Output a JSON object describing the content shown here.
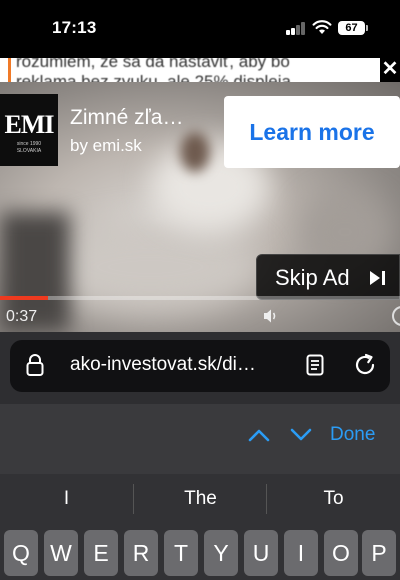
{
  "status_bar": {
    "time": "17:13",
    "battery": "67"
  },
  "article": {
    "line1": "rozumiem, že sa dá nastaviť, aby bo",
    "line2": "reklama bez zvuku, ale 25% displeja"
  },
  "ad": {
    "logo_text": "EMI",
    "logo_sub1": "since 1990",
    "logo_sub2": "SLOVAKIA",
    "title": "Zimné zľa…",
    "by": "by emi.sk",
    "learn_more": "Learn more",
    "skip": "Skip Ad",
    "elapsed": "0:37",
    "progress": 0.12,
    "close": "✕"
  },
  "browser": {
    "url": "ako-investovat.sk/di…"
  },
  "find_bar": {
    "done": "Done"
  },
  "keyboard": {
    "suggestions": [
      "I",
      "The",
      "To"
    ],
    "keys": [
      "Q",
      "W",
      "E",
      "R",
      "T",
      "Y",
      "U",
      "I",
      "O",
      "P"
    ]
  },
  "colors": {
    "accent": "#2b9cf5",
    "learn_more_text": "#1a73e8",
    "progress": "#ee3a1f"
  }
}
